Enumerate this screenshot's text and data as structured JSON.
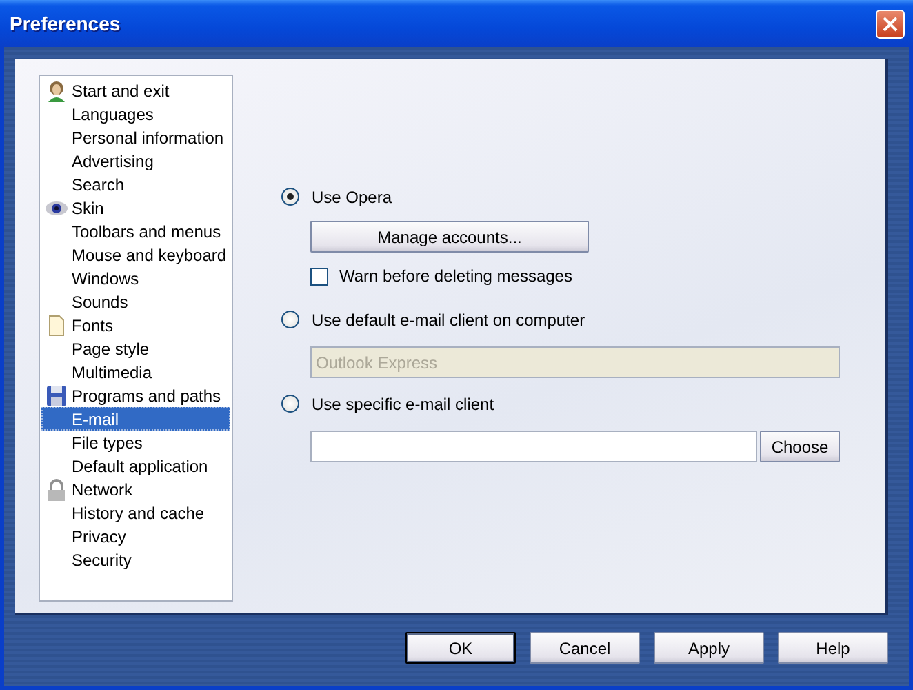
{
  "window": {
    "title": "Preferences"
  },
  "sidebar": {
    "items": [
      {
        "label": "Start and exit",
        "kind": "person",
        "selected": false
      },
      {
        "label": "Languages",
        "kind": "plain",
        "selected": false
      },
      {
        "label": "Personal information",
        "kind": "plain",
        "selected": false
      },
      {
        "label": "Advertising",
        "kind": "plain",
        "selected": false
      },
      {
        "label": "Search",
        "kind": "plain",
        "selected": false
      },
      {
        "label": "Skin",
        "kind": "eye",
        "selected": false
      },
      {
        "label": "Toolbars and menus",
        "kind": "plain",
        "selected": false
      },
      {
        "label": "Mouse and keyboard",
        "kind": "plain",
        "selected": false
      },
      {
        "label": "Windows",
        "kind": "plain",
        "selected": false
      },
      {
        "label": "Sounds",
        "kind": "plain",
        "selected": false
      },
      {
        "label": "Fonts",
        "kind": "page",
        "selected": false
      },
      {
        "label": "Page style",
        "kind": "plain",
        "selected": false
      },
      {
        "label": "Multimedia",
        "kind": "plain",
        "selected": false
      },
      {
        "label": "Programs and paths",
        "kind": "disk",
        "selected": false
      },
      {
        "label": "E-mail",
        "kind": "plain",
        "selected": true
      },
      {
        "label": "File types",
        "kind": "plain",
        "selected": false
      },
      {
        "label": "Default application",
        "kind": "plain",
        "selected": false
      },
      {
        "label": "Network",
        "kind": "lock",
        "selected": false
      },
      {
        "label": "History and cache",
        "kind": "plain",
        "selected": false
      },
      {
        "label": "Privacy",
        "kind": "plain",
        "selected": false
      },
      {
        "label": "Security",
        "kind": "plain",
        "selected": false
      }
    ]
  },
  "email": {
    "options": [
      {
        "label": "Use Opera",
        "selected": true
      },
      {
        "label": "Use default e-mail client on computer",
        "selected": false
      },
      {
        "label": "Use specific e-mail client",
        "selected": false
      }
    ],
    "manage_button": "Manage accounts...",
    "warn_checkbox": {
      "label": "Warn before deleting messages",
      "checked": false
    },
    "default_client_field": {
      "value": "Outlook Express",
      "disabled": true
    },
    "choose_button": "Choose"
  },
  "buttons": [
    {
      "label": "OK",
      "default": true
    },
    {
      "label": "Cancel",
      "default": false
    },
    {
      "label": "Apply",
      "default": false
    },
    {
      "label": "Help",
      "default": false
    }
  ]
}
